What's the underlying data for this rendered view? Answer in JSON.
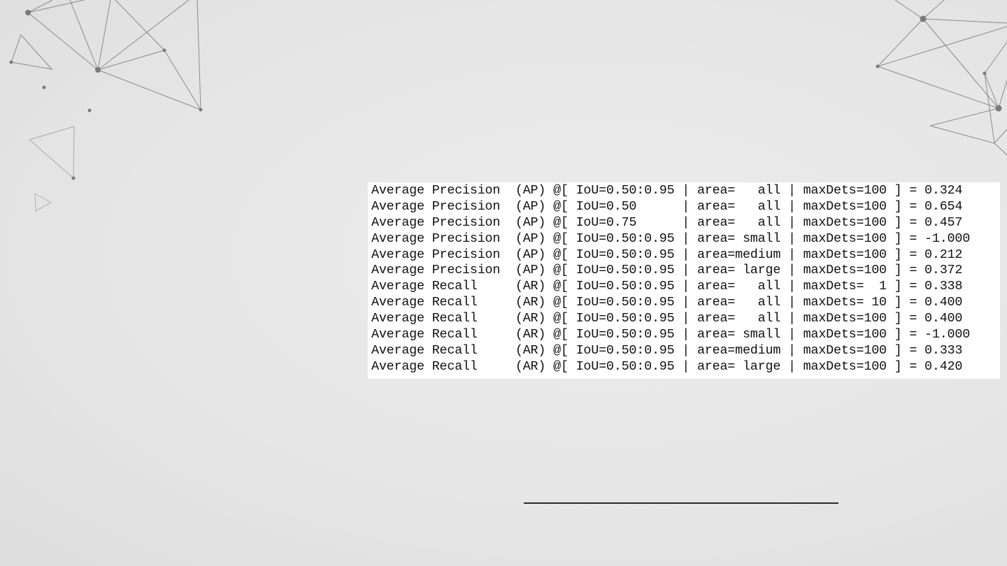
{
  "slide": {
    "background_color": "#e8e8e8",
    "rule_color": "#2a2a2a"
  },
  "evaluation_results": [
    {
      "text": "Average Precision  (AP) @[ IoU=0.50:0.95 | area=   all | maxDets=100 ] = 0.324"
    },
    {
      "text": "Average Precision  (AP) @[ IoU=0.50      | area=   all | maxDets=100 ] = 0.654"
    },
    {
      "text": "Average Precision  (AP) @[ IoU=0.75      | area=   all | maxDets=100 ] = 0.457"
    },
    {
      "text": "Average Precision  (AP) @[ IoU=0.50:0.95 | area= small | maxDets=100 ] = -1.000"
    },
    {
      "text": "Average Precision  (AP) @[ IoU=0.50:0.95 | area=medium | maxDets=100 ] = 0.212"
    },
    {
      "text": "Average Precision  (AP) @[ IoU=0.50:0.95 | area= large | maxDets=100 ] = 0.372"
    },
    {
      "text": "Average Recall     (AR) @[ IoU=0.50:0.95 | area=   all | maxDets=  1 ] = 0.338"
    },
    {
      "text": "Average Recall     (AR) @[ IoU=0.50:0.95 | area=   all | maxDets= 10 ] = 0.400"
    },
    {
      "text": "Average Recall     (AR) @[ IoU=0.50:0.95 | area=   all | maxDets=100 ] = 0.400"
    },
    {
      "text": "Average Recall     (AR) @[ IoU=0.50:0.95 | area= small | maxDets=100 ] = -1.000"
    },
    {
      "text": "Average Recall     (AR) @[ IoU=0.50:0.95 | area=medium | maxDets=100 ] = 0.333"
    },
    {
      "text": "Average Recall     (AR) @[ IoU=0.50:0.95 | area= large | maxDets=100 ] = 0.420"
    }
  ]
}
